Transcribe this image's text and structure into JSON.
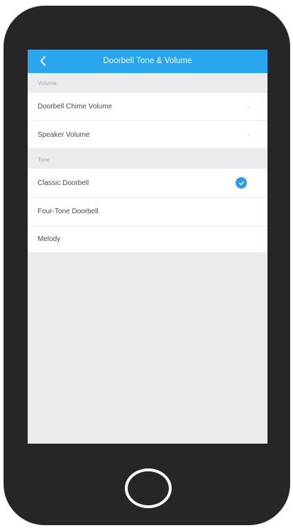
{
  "header": {
    "title": "Doorbell Tone & Volume"
  },
  "sections": {
    "volume_label": "Volume",
    "tone_label": "Tone"
  },
  "volume_rows": [
    {
      "label": "Doorbell Chime Volume"
    },
    {
      "label": "Speaker Volume"
    }
  ],
  "tone_rows": [
    {
      "label": "Classic Doorbell",
      "selected": true
    },
    {
      "label": "Four-Tone Doorbell",
      "selected": false
    },
    {
      "label": "Melody",
      "selected": false
    }
  ],
  "icons": {
    "back": "chevron-left-icon",
    "row_arrow": "chevron-right-icon",
    "selected": "check-circle-icon"
  },
  "colors": {
    "header": "#2aa6ee",
    "accent": "#2a9cf0",
    "phone_body": "#272525",
    "screen_bg": "#ececee"
  }
}
